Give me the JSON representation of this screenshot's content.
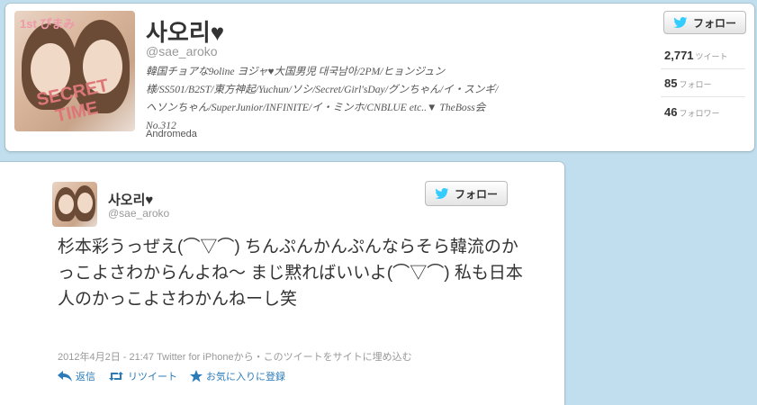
{
  "profile": {
    "name": "사오리♥",
    "handle": "@sae_aroko",
    "bio": "韓国チョアな9oline ヨジャ♥大国男児 대국남아/2PM/ヒョンジュン様/SS501/B2ST/東方神起/Yuchun/ソシ/Secret/Girl'sDay/グンちゃん/イ・スンギ/ヘソンちゃん/SuperJunior/INFINITE/イ・ミンホ/CNBLUE etc..▼ TheBoss会 No.312",
    "location": "Andromeda",
    "avatar_overlay_top": "1st ぴまみ",
    "avatar_overlay_bottom": "SECRET TIME",
    "follow_label": "フォロー",
    "stats": [
      {
        "value": "2,771",
        "label": "ツイート"
      },
      {
        "value": "85",
        "label": "フォロー"
      },
      {
        "value": "46",
        "label": "フォロワー"
      }
    ]
  },
  "tweet": {
    "name": "사오리♥",
    "handle": "@sae_aroko",
    "follow_label": "フォロー",
    "text": "杉本彩うっぜえ(⌒▽⌒) ちんぷんかんぷんならそら韓流のかっこよさわからんよね〜 まじ黙ればいいよ(⌒▽⌒) 私も日本人のかっこよさわかんねーし笑",
    "meta": "2012年4月2日 - 21:47 Twitter for iPhoneから・このツイートをサイトに埋め込む",
    "actions": {
      "reply": "返信",
      "retweet": "リツイート",
      "favorite": "お気に入りに登録"
    }
  },
  "colors": {
    "background": "#c0deed",
    "link": "#2b7bb9",
    "bird": "#33ccff"
  }
}
